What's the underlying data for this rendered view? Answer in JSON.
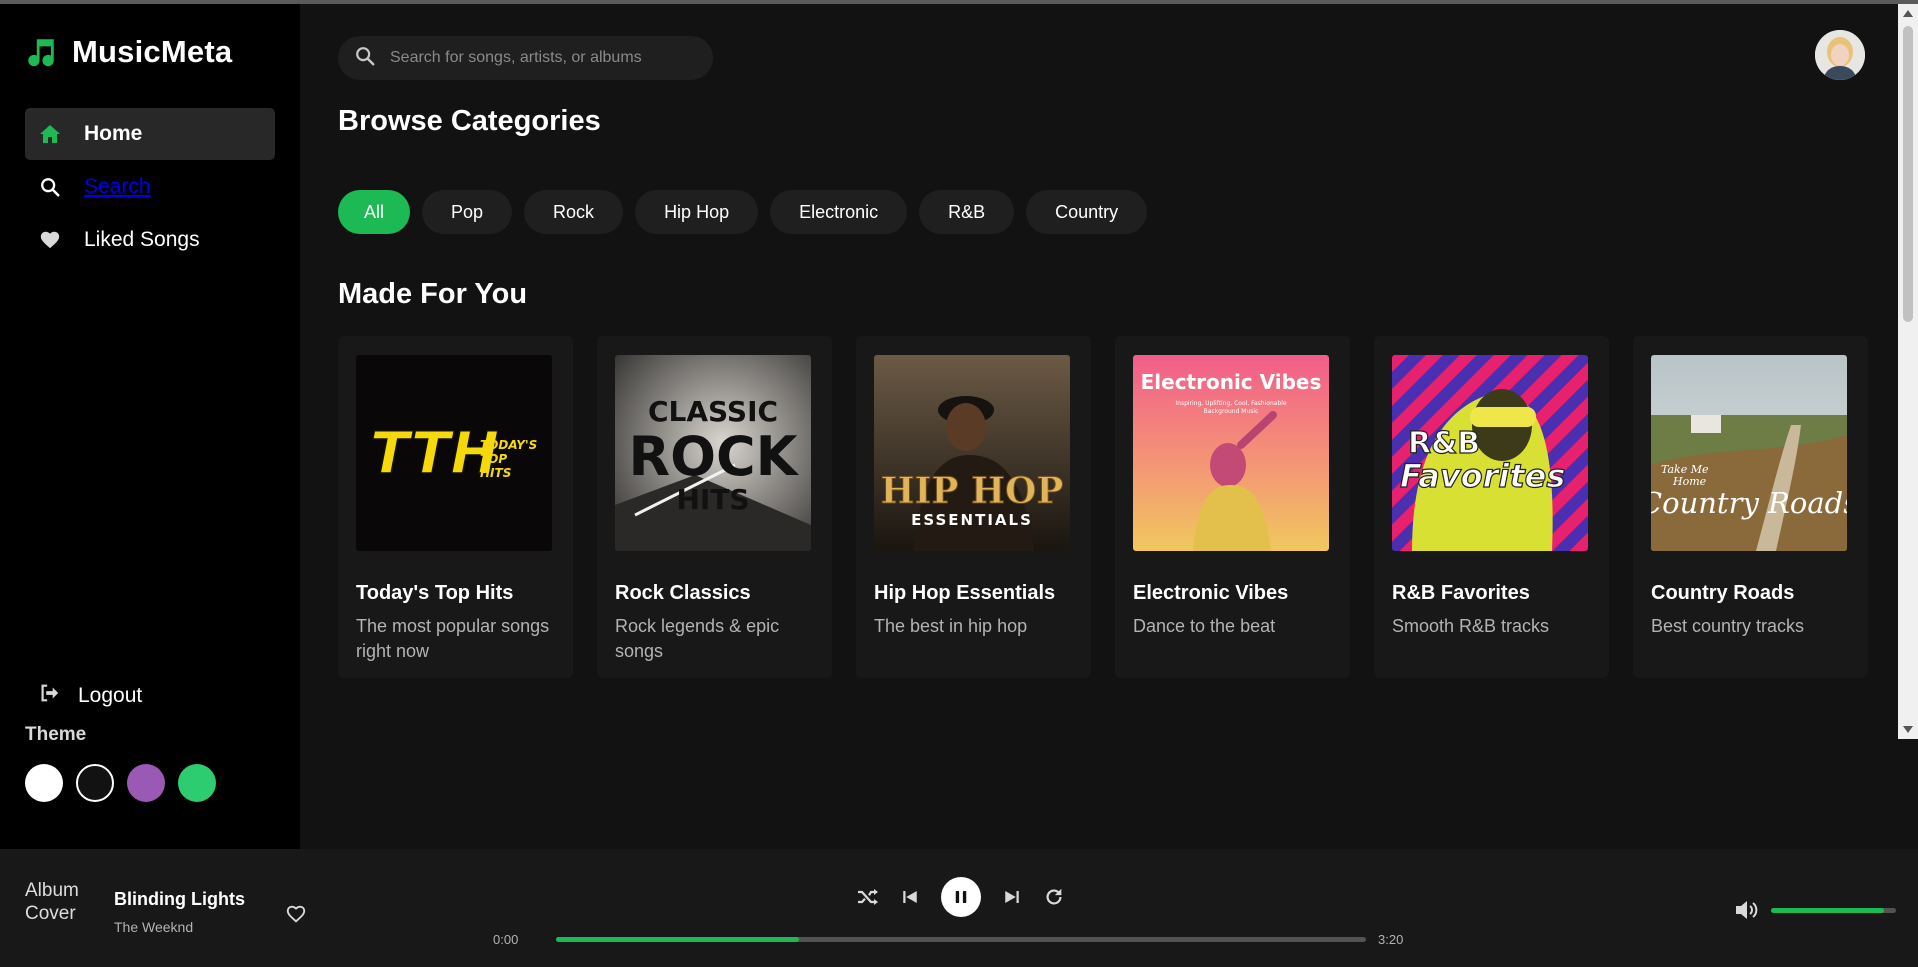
{
  "app": {
    "name": "MusicMeta"
  },
  "sidebar": {
    "items": [
      {
        "label": "Home",
        "icon": "home-icon",
        "active": true
      },
      {
        "label": "Search",
        "icon": "search-icon",
        "link": true
      },
      {
        "label": "Liked Songs",
        "icon": "heart-icon"
      }
    ],
    "logout_label": "Logout",
    "theme_title": "Theme",
    "themes": [
      "#ffffff",
      "#121212",
      "#9b59b6",
      "#2ecc71"
    ]
  },
  "header": {
    "search_placeholder": "Search for songs, artists, or albums"
  },
  "main": {
    "browse_title": "Browse Categories",
    "categories": [
      "All",
      "Pop",
      "Rock",
      "Hip Hop",
      "Electronic",
      "R&B",
      "Country"
    ],
    "active_category": "All",
    "made_for_you_title": "Made For You",
    "playlists": [
      {
        "title": "Today's Top Hits",
        "desc": "The most popular songs right now",
        "cover_text": "TODAY'S TOP HITS"
      },
      {
        "title": "Rock Classics",
        "desc": "Rock legends & epic songs",
        "cover_text": "CLASSIC ROCK HITS"
      },
      {
        "title": "Hip Hop Essentials",
        "desc": "The best in hip hop",
        "cover_text": "HIP HOP ESSENTIALS"
      },
      {
        "title": "Electronic Vibes",
        "desc": "Dance to the beat",
        "cover_text": "Electronic Vibes"
      },
      {
        "title": "R&B Favorites",
        "desc": "Smooth R&B tracks",
        "cover_text": "R&B Favorites"
      },
      {
        "title": "Country Roads",
        "desc": "Best country tracks",
        "cover_text": "Country Roads"
      }
    ]
  },
  "player": {
    "cover_alt": "Album Cover",
    "title": "Blinding Lights",
    "artist": "The Weeknd",
    "current_time": "0:00",
    "duration": "3:20",
    "progress_fraction": 0.3,
    "volume_fraction": 0.9,
    "state": "playing"
  },
  "colors": {
    "accent": "#1db954",
    "background": "#121212",
    "sidebar": "#000000"
  }
}
